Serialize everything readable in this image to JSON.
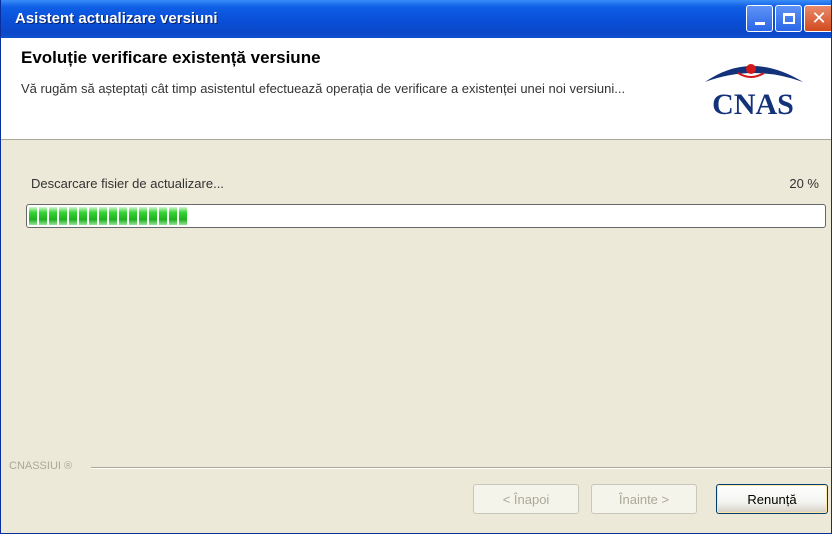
{
  "window": {
    "title": "Asistent actualizare versiuni"
  },
  "header": {
    "title": "Evoluție verificare existență versiune",
    "description": "Vă rugăm să așteptați cât timp asistentul efectuează operația de verificare a existenței unei noi versiuni...",
    "logo_text": "CNAS"
  },
  "progress": {
    "label": "Descarcare fisier de actualizare...",
    "percent_text": "20 %",
    "fraction": 0.2
  },
  "footer": {
    "brand": "CNASSIUI ®",
    "back_label": "< Înapoi",
    "next_label": "Înainte >",
    "cancel_label": "Renunță"
  },
  "colors": {
    "titlebar": "#0a4fd8",
    "window_bg": "#ece9d8",
    "progress_green": "#22b822",
    "logo_blue": "#14327a",
    "logo_red": "#d21a1a"
  }
}
